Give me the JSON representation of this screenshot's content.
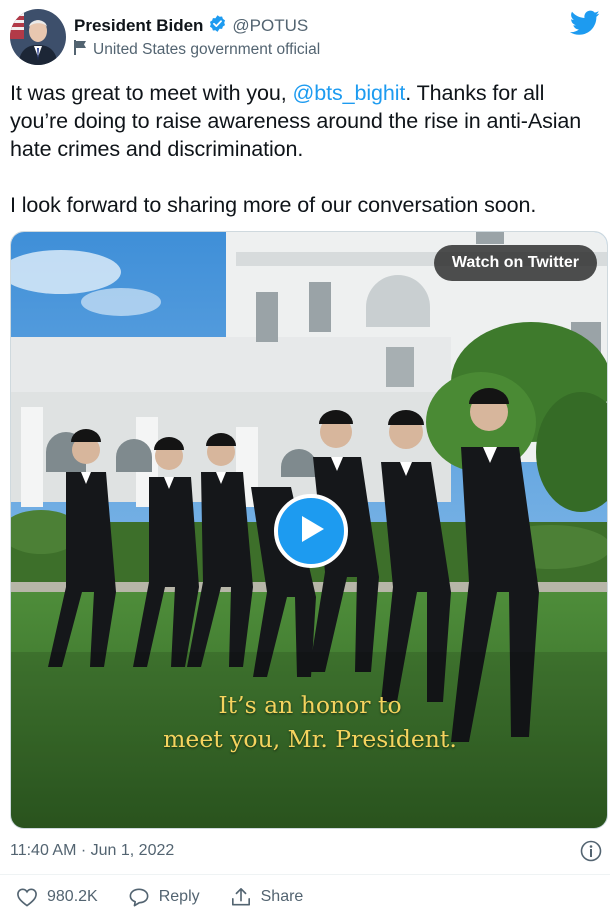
{
  "author": {
    "display_name": "President Biden",
    "handle": "@POTUS",
    "label": "United States government official"
  },
  "tweet": {
    "line1_before": "It was great to meet with you, ",
    "mention": "@bts_bighit",
    "line1_after": ". Thanks for all you’re doing to raise awareness around the rise in anti-Asian hate crimes and discrimination.",
    "line2": "I look forward to sharing more of our conversation soon."
  },
  "media": {
    "watch_label": "Watch on Twitter",
    "caption_line1": "It’s an honor to",
    "caption_line2": "meet you, Mr. President."
  },
  "footer": {
    "timestamp": "11:40 AM · Jun 1, 2022",
    "like_count": "980.2K",
    "reply_label": "Reply",
    "share_label": "Share"
  },
  "colors": {
    "link": "#1d9bf0",
    "verified": "#1d9bf0",
    "caption": "#f4d35e"
  },
  "icons": [
    "twitter-bird-icon",
    "verified-badge-icon",
    "government-flag-icon",
    "play-icon",
    "info-icon",
    "heart-icon",
    "reply-icon",
    "share-icon"
  ]
}
